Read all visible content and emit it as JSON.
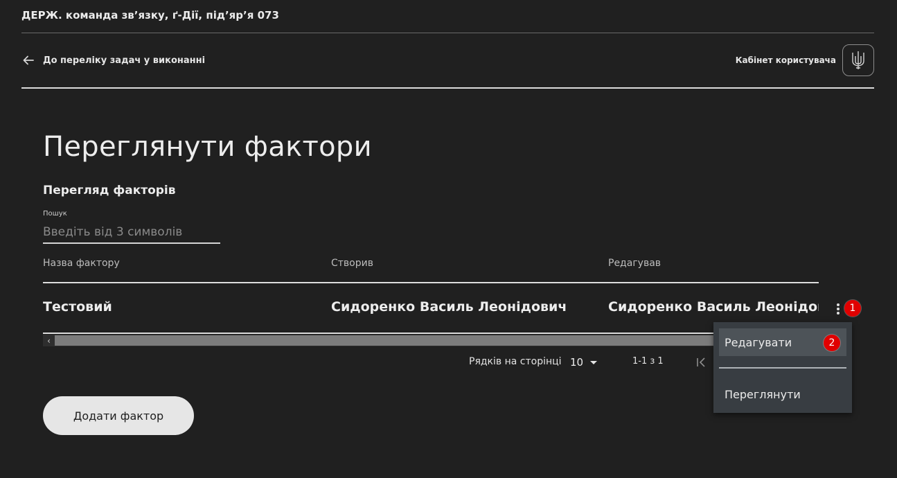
{
  "header": {
    "org_title": "ДЕРЖ. команда зв’язку, ґ-Дії, під’яр’я 073"
  },
  "nav": {
    "back_label": "До переліку задач у виконанні",
    "cabinet_label": "Кабінет користувача",
    "emblem_icon": "trident-emblem-icon"
  },
  "main": {
    "title": "Переглянути фактори",
    "section_title": "Перегляд факторів",
    "search": {
      "label": "Пошук",
      "placeholder": "Введіть від 3 символів",
      "value": ""
    },
    "table": {
      "columns": [
        "Назва фактору",
        "Створив",
        "Редагував"
      ],
      "rows": [
        [
          "Тестовий",
          "Сидоренко Василь Леонідович",
          "Сидоренко Василь Леонідович"
        ]
      ]
    },
    "pagination": {
      "rows_per_page_label": "Рядків на сторінці",
      "rows_per_page_value": "10",
      "range_label": "1-1 з 1"
    },
    "add_button_label": "Додати фактор"
  },
  "row_menu": {
    "items": [
      "Редагувати",
      "Переглянути"
    ]
  },
  "annotations": {
    "badge_1": "1",
    "badge_2": "2"
  },
  "colors": {
    "background": "#202020",
    "menu_background": "#383d42",
    "badge": "#e00000",
    "button": "#e6e6e6"
  }
}
